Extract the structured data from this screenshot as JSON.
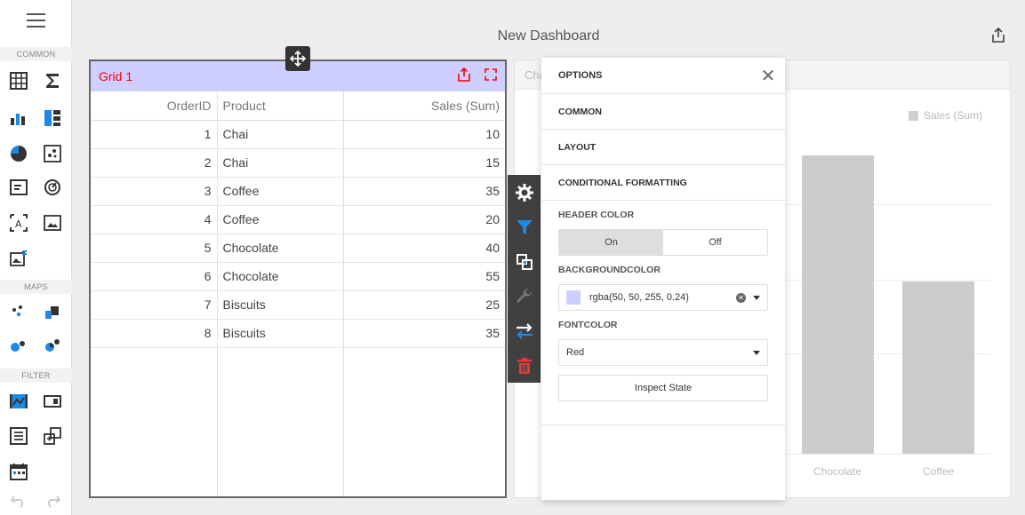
{
  "toolbox": {
    "groups": {
      "common": "COMMON",
      "maps": "MAPS",
      "filter": "FILTER"
    }
  },
  "dashboard": {
    "title": "New Dashboard"
  },
  "grid": {
    "caption": "Grid 1",
    "columns": [
      "OrderID",
      "Product",
      "Sales (Sum)"
    ],
    "rows": [
      {
        "id": "1",
        "product": "Chai",
        "sales": "10"
      },
      {
        "id": "2",
        "product": "Chai",
        "sales": "15"
      },
      {
        "id": "3",
        "product": "Coffee",
        "sales": "35"
      },
      {
        "id": "4",
        "product": "Coffee",
        "sales": "20"
      },
      {
        "id": "5",
        "product": "Chocolate",
        "sales": "40"
      },
      {
        "id": "6",
        "product": "Chocolate",
        "sales": "55"
      },
      {
        "id": "7",
        "product": "Biscuits",
        "sales": "25"
      },
      {
        "id": "8",
        "product": "Biscuits",
        "sales": "35"
      }
    ]
  },
  "chart": {
    "caption": "Cha",
    "legend": "Sales (Sum)",
    "categories": [
      "Chocolate",
      "Coffee"
    ],
    "colors": {
      "bar": "#cccccc"
    }
  },
  "options": {
    "title": "OPTIONS",
    "sections": [
      "COMMON",
      "LAYOUT",
      "CONDITIONAL FORMATTING"
    ],
    "header_color_label": "HEADER COLOR",
    "toggle_on": "On",
    "toggle_off": "Off",
    "bg_label": "BACKGROUNDCOLOR",
    "bg_value": "rgba(50, 50, 255, 0.24)",
    "font_label": "FONTCOLOR",
    "font_value": "Red",
    "inspect": "Inspect State"
  },
  "colors": {
    "accent": "#ff0000",
    "header_bg": "rgba(50,50,255,0.24)",
    "filter_icon": "#1e88e5",
    "delete_icon": "#e53935"
  }
}
